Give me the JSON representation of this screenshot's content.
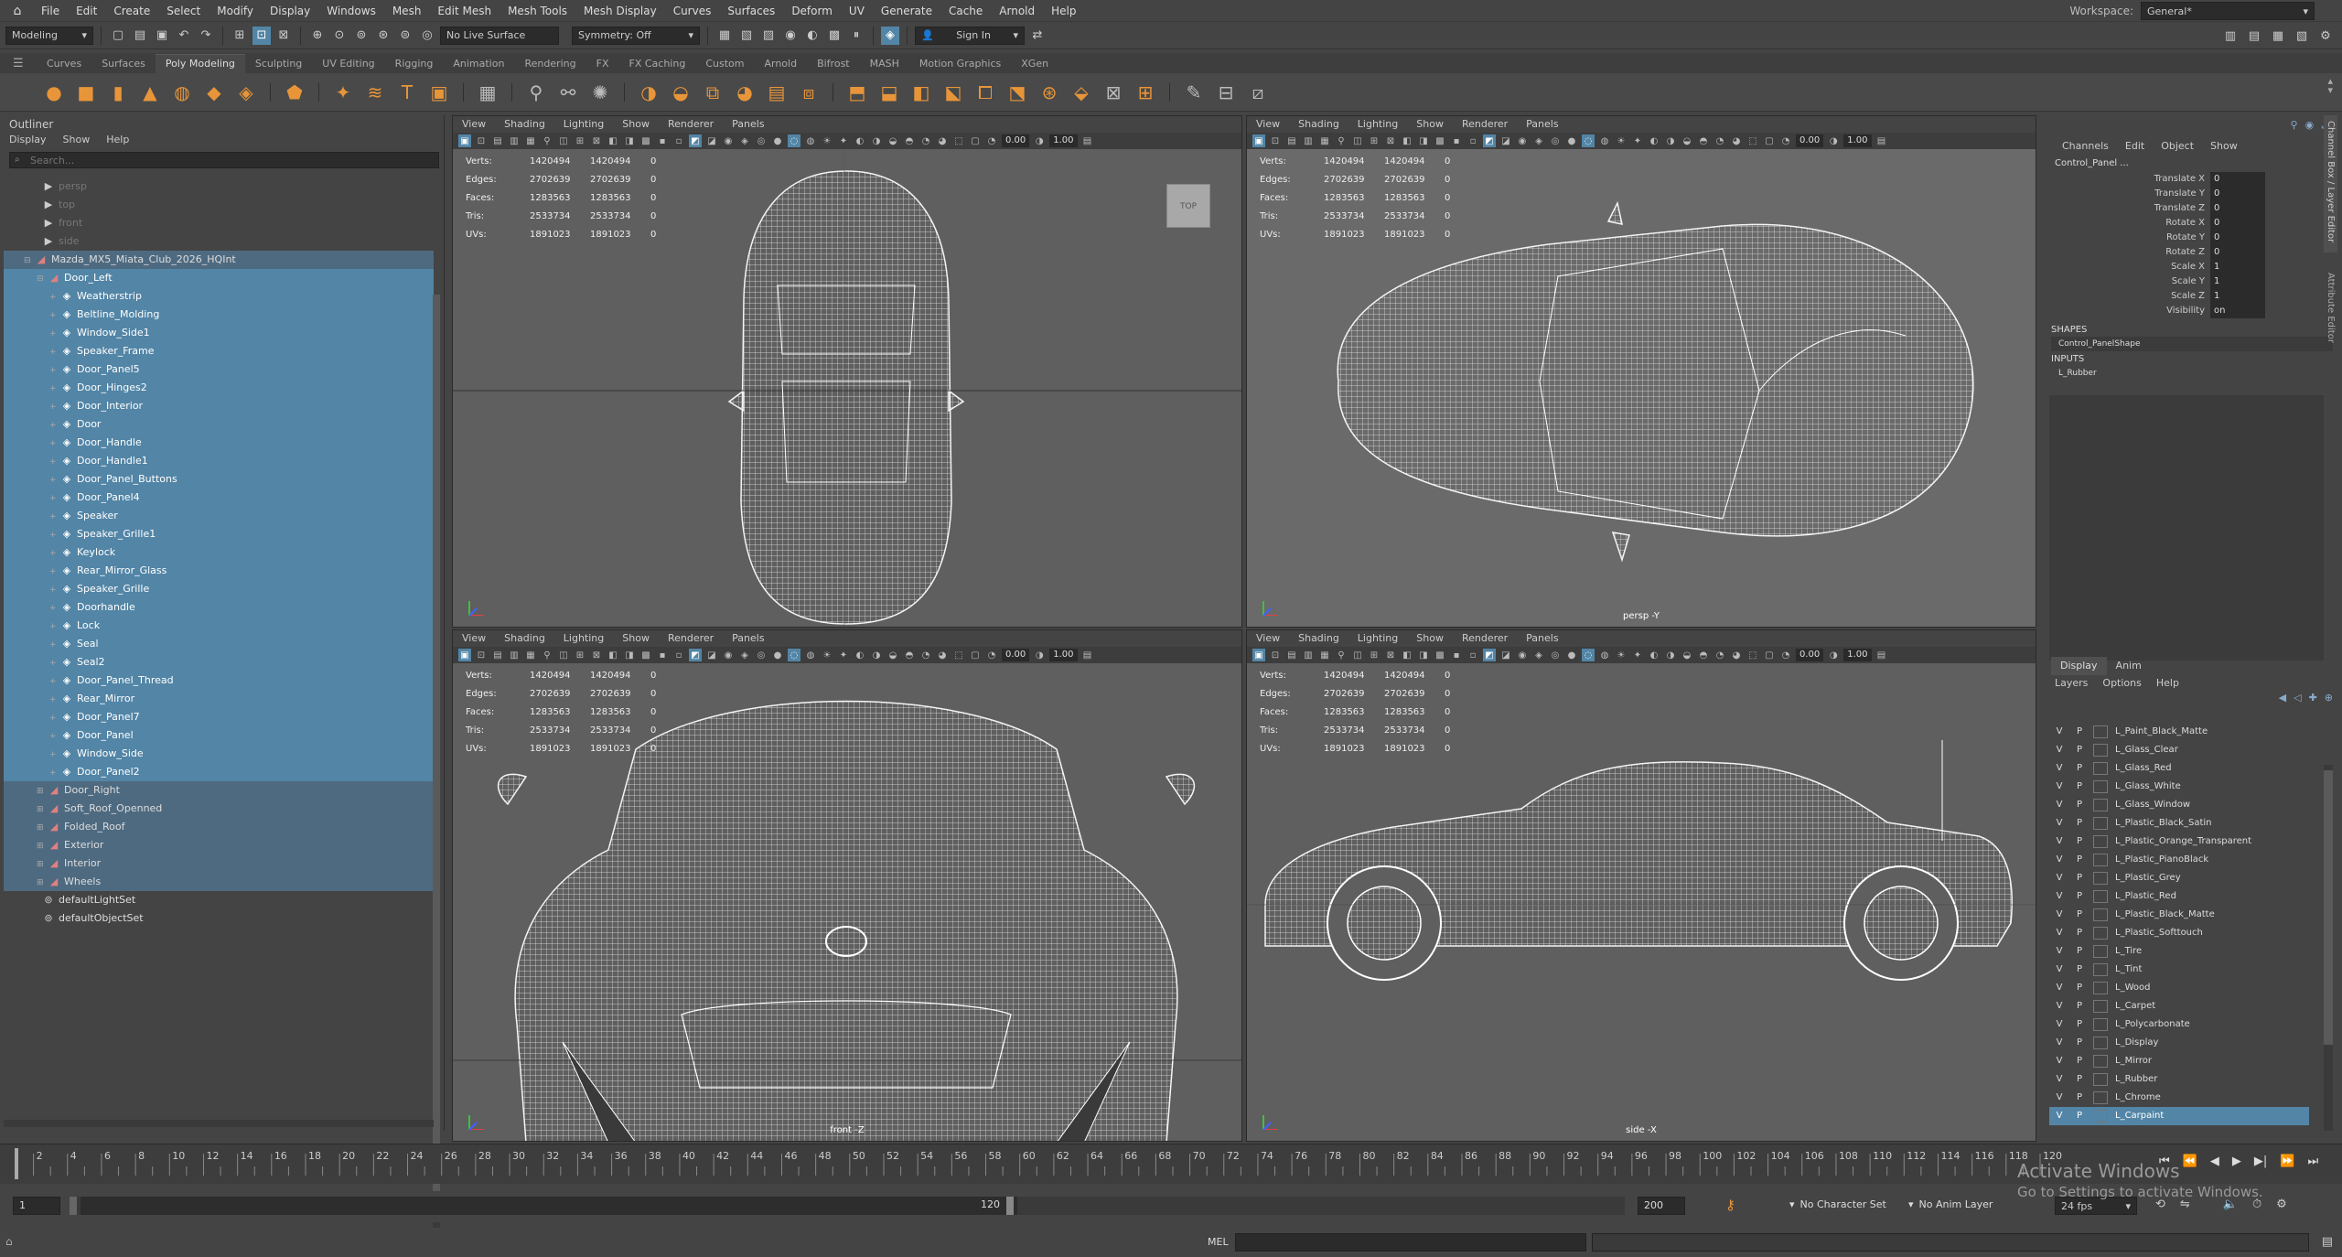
{
  "menubar": {
    "items": [
      "File",
      "Edit",
      "Create",
      "Select",
      "Modify",
      "Display",
      "Windows",
      "Mesh",
      "Edit Mesh",
      "Mesh Tools",
      "Mesh Display",
      "Curves",
      "Surfaces",
      "Deform",
      "UV",
      "Generate",
      "Cache",
      "Arnold",
      "Help"
    ],
    "workspace_label": "Workspace:",
    "workspace_value": "General*"
  },
  "statusline": {
    "mode": "Modeling",
    "live_surface": "No Live Surface",
    "symmetry": "Symmetry: Off",
    "sign_in": "Sign In"
  },
  "shelf": {
    "tabs": [
      "Curves",
      "Surfaces",
      "Poly Modeling",
      "Sculpting",
      "UV Editing",
      "Rigging",
      "Animation",
      "Rendering",
      "FX",
      "FX Caching",
      "Custom",
      "Arnold",
      "Bifrost",
      "MASH",
      "Motion Graphics",
      "XGen"
    ],
    "active_tab": "Poly Modeling"
  },
  "outliner": {
    "title": "Outliner",
    "menu": [
      "Display",
      "Show",
      "Help"
    ],
    "search_placeholder": "Search...",
    "cameras": [
      "persp",
      "top",
      "front",
      "side"
    ],
    "root": "Mazda_MX5_Miata_Club_2026_HQInt",
    "door_left": "Door_Left",
    "door_left_children": [
      "Weatherstrip",
      "Beltline_Molding",
      "Window_Side1",
      "Speaker_Frame",
      "Door_Panel5",
      "Door_Hinges2",
      "Door_Interior",
      "Door",
      "Door_Handle",
      "Door_Handle1",
      "Door_Panel_Buttons",
      "Door_Panel4",
      "Speaker",
      "Speaker_Grille1",
      "Keylock",
      "Rear_Mirror_Glass",
      "Speaker_Grille",
      "Doorhandle",
      "Lock",
      "Seal",
      "Seal2",
      "Door_Panel_Thread",
      "Rear_Mirror",
      "Door_Panel7",
      "Door_Panel",
      "Window_Side",
      "Door_Panel2"
    ],
    "siblings": [
      "Door_Right",
      "Soft_Roof_Openned",
      "Folded_Roof",
      "Exterior",
      "Interior",
      "Wheels"
    ],
    "sets": [
      "defaultLightSet",
      "defaultObjectSet"
    ]
  },
  "viewport": {
    "menu": [
      "View",
      "Shading",
      "Lighting",
      "Show",
      "Renderer",
      "Panels"
    ],
    "field_exposure": "0.00",
    "field_gamma": "1.00",
    "hud": [
      {
        "label": "Verts:",
        "a": "1420494",
        "b": "1420494",
        "c": "0"
      },
      {
        "label": "Edges:",
        "a": "2702639",
        "b": "2702639",
        "c": "0"
      },
      {
        "label": "Faces:",
        "a": "1283563",
        "b": "1283563",
        "c": "0"
      },
      {
        "label": "Tris:",
        "a": "2533734",
        "b": "2533734",
        "c": "0"
      },
      {
        "label": "UVs:",
        "a": "1891023",
        "b": "1891023",
        "c": "0"
      }
    ],
    "top_cube": "TOP",
    "label_persp": "persp -Y",
    "label_front": "front -Z",
    "label_side": "side -X"
  },
  "channelbox": {
    "menu": [
      "Channels",
      "Edit",
      "Object",
      "Show"
    ],
    "object": "Control_Panel ...",
    "attrs": [
      {
        "name": "Translate X",
        "value": "0"
      },
      {
        "name": "Translate Y",
        "value": "0"
      },
      {
        "name": "Translate Z",
        "value": "0"
      },
      {
        "name": "Rotate X",
        "value": "0"
      },
      {
        "name": "Rotate Y",
        "value": "0"
      },
      {
        "name": "Rotate Z",
        "value": "0"
      },
      {
        "name": "Scale X",
        "value": "1"
      },
      {
        "name": "Scale Y",
        "value": "1"
      },
      {
        "name": "Scale Z",
        "value": "1"
      },
      {
        "name": "Visibility",
        "value": "on"
      }
    ],
    "shapes_title": "SHAPES",
    "shape": "Control_PanelShape",
    "inputs_title": "INPUTS",
    "input": "L_Rubber",
    "side_tabs": [
      "Channel Box / Layer Editor",
      "Attribute Editor"
    ]
  },
  "layers": {
    "tabs": [
      "Display",
      "Anim"
    ],
    "menu": [
      "Layers",
      "Options",
      "Help"
    ],
    "v": "V",
    "p": "P",
    "items": [
      "L_Paint_Black_Matte",
      "L_Glass_Clear",
      "L_Glass_Red",
      "L_Glass_White",
      "L_Glass_Window",
      "L_Plastic_Black_Satin",
      "L_Plastic_Orange_Transparent",
      "L_Plastic_PianoBlack",
      "L_Plastic_Grey",
      "L_Plastic_Red",
      "L_Plastic_Black_Matte",
      "L_Plastic_Softtouch",
      "L_Tire",
      "L_Tint",
      "L_Wood",
      "L_Carpet",
      "L_Polycarbonate",
      "L_Display",
      "L_Mirror",
      "L_Rubber",
      "L_Chrome",
      "L_Carpaint"
    ],
    "selected": "L_Carpaint"
  },
  "timeline": {
    "ticks": [
      "2",
      "4",
      "6",
      "8",
      "10",
      "12",
      "14",
      "16",
      "18",
      "20",
      "22",
      "24",
      "26",
      "28",
      "30",
      "32",
      "34",
      "36",
      "38",
      "40",
      "42",
      "44",
      "46",
      "48",
      "50",
      "52",
      "54",
      "56",
      "58",
      "60",
      "62",
      "64",
      "66",
      "68",
      "70",
      "72",
      "74",
      "76",
      "78",
      "80",
      "82",
      "84",
      "86",
      "88",
      "90",
      "92",
      "94",
      "96",
      "98",
      "100",
      "102",
      "104",
      "106",
      "108",
      "110",
      "112",
      "114",
      "116",
      "118",
      "120"
    ],
    "current": "1"
  },
  "range": {
    "start": "1",
    "inner_start": "1",
    "inner_end": "120",
    "end": "200",
    "character_set": "No Character Set",
    "anim_layer": "No Anim Layer",
    "fps": "24 fps"
  },
  "cmdline": {
    "label": "MEL"
  },
  "watermark": {
    "title": "Activate Windows",
    "sub": "Go to Settings to activate Windows."
  },
  "colors": {
    "selection": "#5285a6",
    "shelf_icon": "#e8953a",
    "panel_bg": "#444444"
  }
}
